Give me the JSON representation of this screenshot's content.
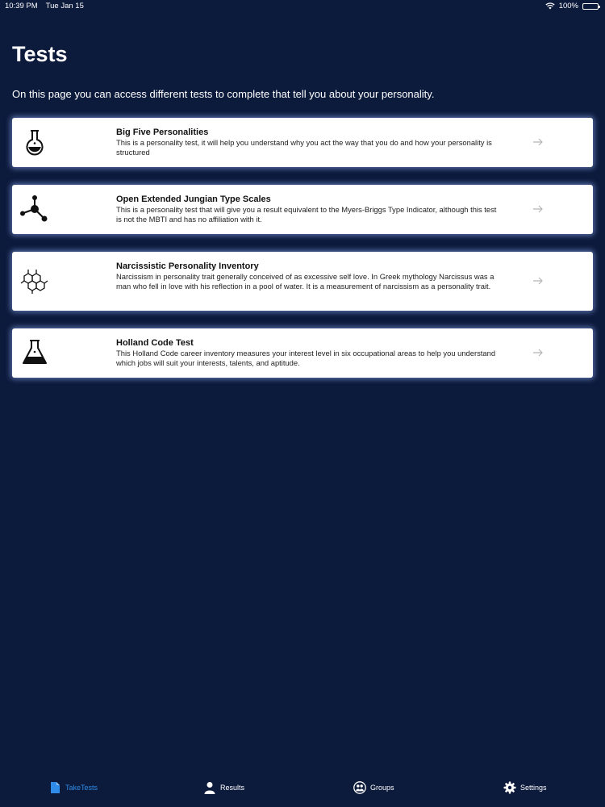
{
  "status_bar": {
    "time": "10:39 PM",
    "date": "Tue Jan 15",
    "battery": "100%"
  },
  "header": {
    "title": "Tests",
    "description": "On this page you can access different tests to complete that tell you about your personality."
  },
  "tests": [
    {
      "title": "Big Five Personalities",
      "description": "This is a personality test, it will help you understand why you act the way that you do and how your personality is structured",
      "icon": "flask-round-icon"
    },
    {
      "title": "Open Extended Jungian Type Scales",
      "description": "This is a personality test that will give you a result equivalent to the Myers-Briggs Type Indicator, although this test is not the MBTI and has no affiliation with it.",
      "icon": "molecule-icon"
    },
    {
      "title": "Narcissistic Personality Inventory",
      "description": "Narcissism in personality trait generally conceived of as excessive self love. In Greek mythology Narcissus was a man who fell in love with his reflection in a pool of water. It is a measurement of narcissism as a personality trait.",
      "icon": "hexagon-structure-icon"
    },
    {
      "title": "Holland Code Test",
      "description": "This Holland Code career inventory measures your interest level in six occupational areas to help you understand which jobs will suit your interests, talents, and aptitude.",
      "icon": "erlenmeyer-flask-icon"
    }
  ],
  "tab_bar": {
    "tabs": [
      {
        "label": "TakeTests",
        "icon": "document-icon",
        "active": true
      },
      {
        "label": "Results",
        "icon": "person-icon",
        "active": false
      },
      {
        "label": "Groups",
        "icon": "group-icon",
        "active": false
      },
      {
        "label": "Settings",
        "icon": "gear-icon",
        "active": false
      }
    ]
  },
  "colors": {
    "background": "#0c1a3c",
    "card": "#ffffff",
    "accent": "#2f8ce8",
    "card_glow": "#96b4ff"
  }
}
